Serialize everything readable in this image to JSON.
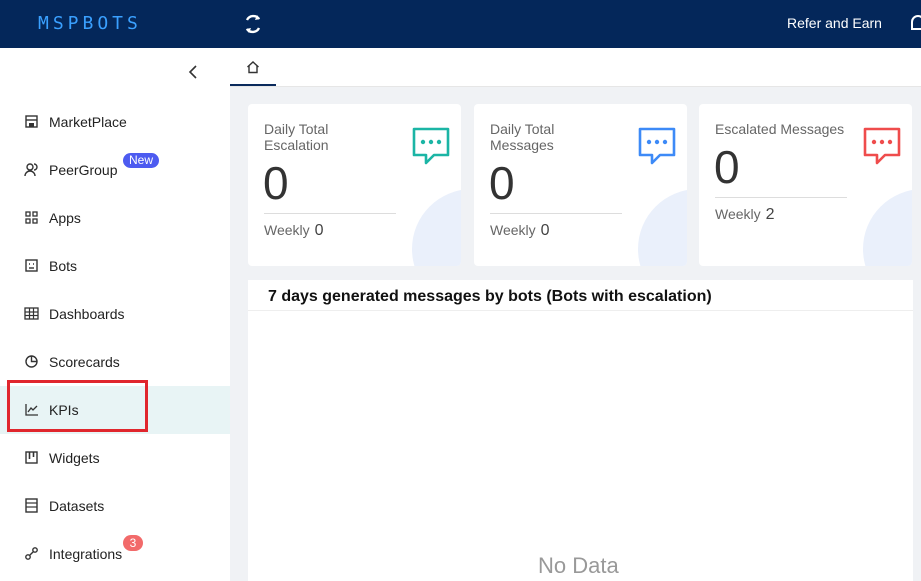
{
  "header": {
    "logo_text": "MSPBOTS",
    "refer_label": "Refer and Earn",
    "icons": [
      "refresh-icon",
      "bell-icon"
    ]
  },
  "sidebar": {
    "collapse_icon": "chevron-left-icon",
    "items": [
      {
        "label": "MarketPlace",
        "icon": "store-icon"
      },
      {
        "label": "PeerGroup",
        "icon": "users-icon",
        "badge": "New"
      },
      {
        "label": "Apps",
        "icon": "grid-icon"
      },
      {
        "label": "Bots",
        "icon": "bot-icon"
      },
      {
        "label": "Dashboards",
        "icon": "table-icon"
      },
      {
        "label": "Scorecards",
        "icon": "pie-icon"
      },
      {
        "label": "KPIs",
        "icon": "line-chart-icon",
        "active": true
      },
      {
        "label": "Widgets",
        "icon": "widget-icon"
      },
      {
        "label": "Datasets",
        "icon": "dataset-icon"
      },
      {
        "label": "Integrations",
        "icon": "plug-icon",
        "badge": "3"
      }
    ]
  },
  "tabs": {
    "home_icon": "home-icon"
  },
  "cards": [
    {
      "title": "Daily Total Escalation",
      "value": "0",
      "weekly_label": "Weekly",
      "weekly_value": "0",
      "accent": "#1bb5a5"
    },
    {
      "title": "Daily Total Messages",
      "value": "0",
      "weekly_label": "Weekly",
      "weekly_value": "0",
      "accent": "#3d8af7"
    },
    {
      "title": "Escalated Messages",
      "value": "0",
      "weekly_label": "Weekly",
      "weekly_value": "2",
      "accent": "#ef4c4c"
    }
  ],
  "panel": {
    "title": "7 days generated messages by bots (Bots with escalation)",
    "empty_text": "No Data"
  },
  "colors": {
    "topbar": "#04275a",
    "active_nav": "#e8f4f5",
    "highlight_box": "#e0262d"
  }
}
